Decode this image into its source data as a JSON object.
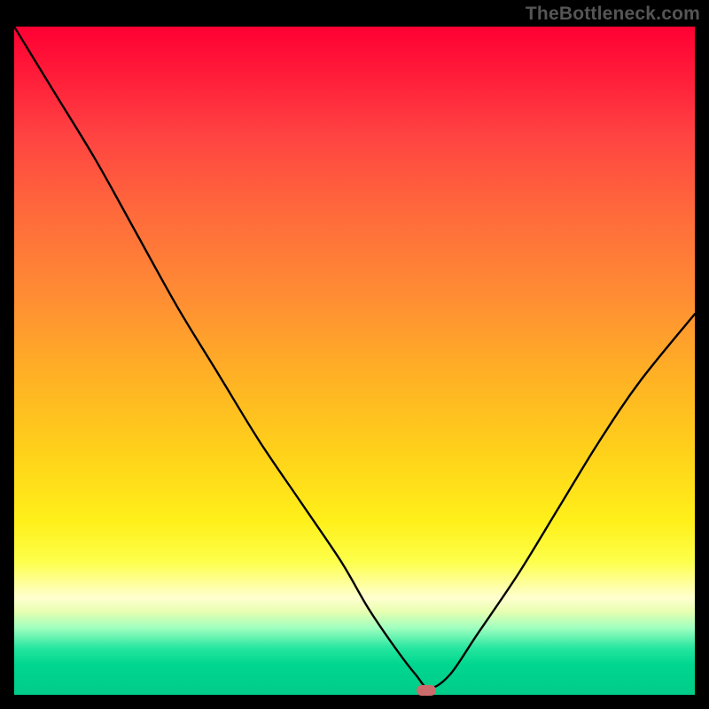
{
  "watermark": "TheBottleneck.com",
  "colors": {
    "background": "#000000",
    "curve": "#000000",
    "marker": "#cc6b6b",
    "gradient_top": "#ff0033",
    "gradient_bottom": "#00cc88"
  },
  "chart_data": {
    "type": "line",
    "title": "",
    "xlabel": "",
    "ylabel": "",
    "xlim": [
      0,
      100
    ],
    "ylim": [
      0,
      100
    ],
    "grid": false,
    "x": [
      0,
      6,
      12,
      18,
      24,
      30,
      36,
      42,
      48,
      52,
      56,
      59,
      61,
      64,
      68,
      74,
      80,
      86,
      92,
      100
    ],
    "values": [
      100,
      90,
      80,
      69,
      58,
      48,
      38,
      29,
      20,
      13,
      7,
      3,
      1,
      3,
      9,
      18,
      28,
      38,
      47,
      57
    ],
    "marker": {
      "x": 60.5,
      "y": 0.7
    }
  }
}
